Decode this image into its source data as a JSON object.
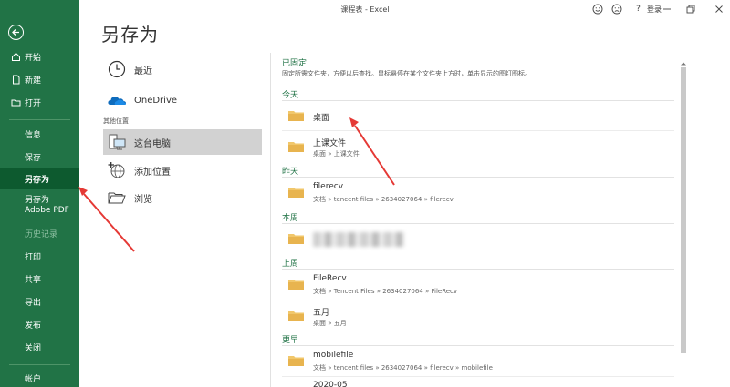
{
  "window": {
    "title": "课程表 - Excel",
    "login": "登录",
    "help": "?"
  },
  "page": {
    "title": "另存为"
  },
  "sidebar": {
    "top": [
      {
        "label": "开始",
        "icon": "home-icon"
      },
      {
        "label": "新建",
        "icon": "new-file-icon"
      },
      {
        "label": "打开",
        "icon": "folder-open-icon"
      }
    ],
    "middle": [
      {
        "label": "信息"
      },
      {
        "label": "保存"
      },
      {
        "label": "另存为"
      },
      {
        "label": "另存为 Adobe PDF"
      },
      {
        "label": "历史记录"
      },
      {
        "label": "打印"
      },
      {
        "label": "共享"
      },
      {
        "label": "导出"
      },
      {
        "label": "发布"
      },
      {
        "label": "关闭"
      }
    ],
    "bottom": [
      {
        "label": "帐户"
      }
    ]
  },
  "locations": {
    "recent": "最近",
    "onedrive": "OneDrive",
    "other_label": "其他位置",
    "this_pc": "这台电脑",
    "add_place": "添加位置",
    "browse": "浏览"
  },
  "list": {
    "pinned_head": "已固定",
    "pinned_hint": "固定所需文件夹，方便以后查找。鼠标悬停在某个文件夹上方时，单击显示的图钉图标。",
    "groups": {
      "today": "今天",
      "yesterday": "昨天",
      "this_week": "本周",
      "last_week": "上周",
      "older": "更早"
    },
    "items": [
      {
        "name": "桌面",
        "path": ""
      },
      {
        "name": "上课文件",
        "path": "桌面 » 上课文件"
      },
      {
        "name": "filerecv",
        "path": "文档 » tencent files » 2634027064 » filerecv"
      },
      {
        "name": "",
        "path": ""
      },
      {
        "name": "FileRecv",
        "path": "文档 » Tencent Files » 2634027064 » FileRecv"
      },
      {
        "name": "五月",
        "path": "桌面 » 五月"
      },
      {
        "name": "mobilefile",
        "path": "文档 » tencent files » 2634027064 » filerecv » mobilefile"
      },
      {
        "name": "2020-05",
        "path": ""
      }
    ]
  },
  "colors": {
    "sidebar": "#217346",
    "sidebar_active": "#0d5a2f",
    "accent": "#217346",
    "folder": "#f1c76b",
    "arrow": "#e53935"
  }
}
